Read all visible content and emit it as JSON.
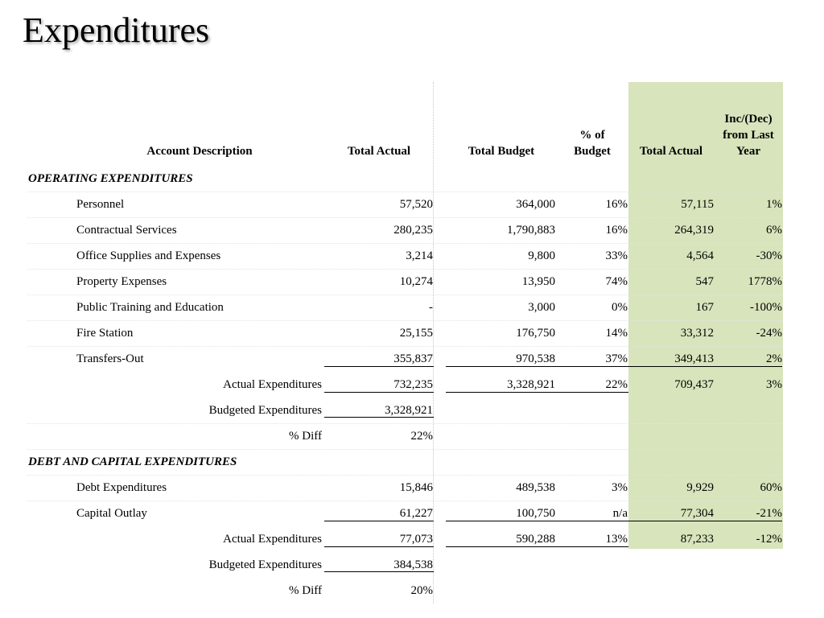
{
  "title": "Expenditures",
  "colors": {
    "highlight": "#d8e4bc"
  },
  "headers": {
    "desc": "Account Description",
    "actual": "Total Actual",
    "budget": "Total Budget",
    "pct_line1": "% of",
    "pct_line2": "Budget",
    "prior_actual": "Total Actual",
    "inc_line1": "Inc/(Dec)",
    "inc_line2": "from Last",
    "inc_line3": "Year"
  },
  "operating": {
    "section": "OPERATING EXPENDITURES",
    "rows": [
      {
        "desc": "Personnel",
        "actual": "57,520",
        "budget": "364,000",
        "pct": "16%",
        "prior": "57,115",
        "inc": "1%"
      },
      {
        "desc": "Contractual Services",
        "actual": "280,235",
        "budget": "1,790,883",
        "pct": "16%",
        "prior": "264,319",
        "inc": "6%"
      },
      {
        "desc": "Office Supplies and Expenses",
        "actual": "3,214",
        "budget": "9,800",
        "pct": "33%",
        "prior": "4,564",
        "inc": "-30%"
      },
      {
        "desc": "Property Expenses",
        "actual": "10,274",
        "budget": "13,950",
        "pct": "74%",
        "prior": "547",
        "inc": "1778%"
      },
      {
        "desc": "Public Training and Education",
        "actual": "-",
        "budget": "3,000",
        "pct": "0%",
        "prior": "167",
        "inc": "-100%"
      },
      {
        "desc": "Fire Station",
        "actual": "25,155",
        "budget": "176,750",
        "pct": "14%",
        "prior": "33,312",
        "inc": "-24%"
      },
      {
        "desc": "Transfers-Out",
        "actual": "355,837",
        "budget": "970,538",
        "pct": "37%",
        "prior": "349,413",
        "inc": "2%"
      }
    ],
    "total": {
      "label": "Actual Expenditures",
      "actual": "732,235",
      "budget": "3,328,921",
      "pct": "22%",
      "prior": "709,437",
      "inc": "3%"
    },
    "budgeted": {
      "label": "Budgeted Expenditures",
      "value": "3,328,921"
    },
    "diff": {
      "label": "% Diff",
      "value": "22%"
    }
  },
  "debt": {
    "section": "DEBT AND CAPITAL EXPENDITURES",
    "rows": [
      {
        "desc": "Debt Expenditures",
        "actual": "15,846",
        "budget": "489,538",
        "pct": "3%",
        "prior": "9,929",
        "inc": "60%"
      },
      {
        "desc": "Capital Outlay",
        "actual": "61,227",
        "budget": "100,750",
        "pct": "n/a",
        "prior": "77,304",
        "inc": "-21%"
      }
    ],
    "total": {
      "label": "Actual Expenditures",
      "actual": "77,073",
      "budget": "590,288",
      "pct": "13%",
      "prior": "87,233",
      "inc": "-12%"
    },
    "budgeted": {
      "label": "Budgeted Expenditures",
      "value": "384,538"
    },
    "diff": {
      "label": "% Diff",
      "value": "20%"
    }
  }
}
